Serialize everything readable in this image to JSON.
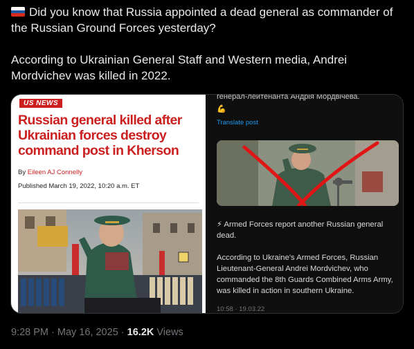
{
  "tweet": {
    "flag_icon": "russia-flag-icon",
    "line1": "Did you know that Russia appointed a dead general as commander of",
    "line2": "the Russian Ground Forces yesterday?",
    "line3": "According to Ukrainian General Staff and Western media, Andrei",
    "line4": "Mordvichev was killed in 2022."
  },
  "article": {
    "badge": "US NEWS",
    "headline_1": "Russian general killed after",
    "headline_2": "Ukrainian forces destroy",
    "headline_3": "command post in Kherson",
    "by_prefix": "By ",
    "author": "Eileen AJ Connelly",
    "published": "Published March 19, 2022, 10:20 a.m. ET",
    "colors": {
      "accent": "#cc1f1f"
    }
  },
  "embedded_post": {
    "cyrillic": "генерал-лейтенанта Андрія Мордвічева.",
    "arm_icon": "flexed-biceps-icon",
    "translate": "Translate post",
    "line1": "⚡ Armed Forces report another Russian general",
    "line2": "dead.",
    "line3": "According to Ukraine's Armed Forces, Russian",
    "line4": "Lieutenant-General Andrei Mordvichev, who",
    "line5": "commanded the 8th Guards Combined Arms Army,",
    "line6": "was killed in action in southern Ukraine.",
    "time": "10:58 · 19.03.22"
  },
  "meta": {
    "time": "9:28 PM",
    "sep1": " · ",
    "date": "May 16, 2025",
    "sep2": " · ",
    "views_count": "16.2K",
    "views_label": " Views"
  }
}
